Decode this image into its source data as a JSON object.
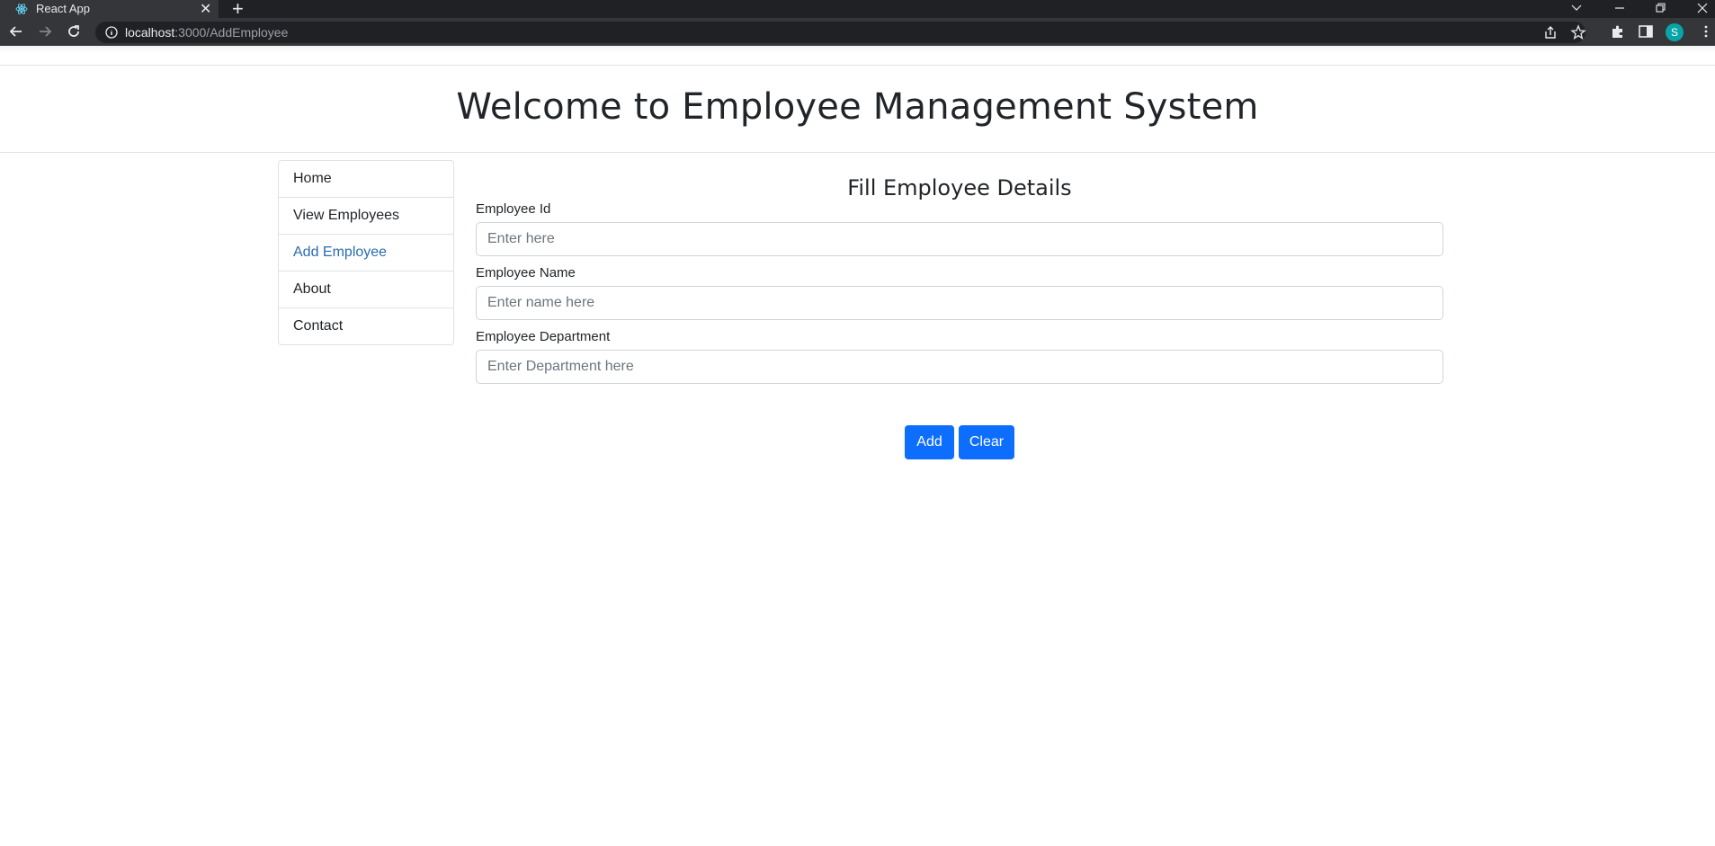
{
  "browser": {
    "tab_title": "React App",
    "url_host": "localhost",
    "url_path": ":3000/AddEmployee",
    "profile_initial": "S"
  },
  "page": {
    "heading": "Welcome to Employee Management System"
  },
  "sidebar": {
    "items": [
      {
        "label": "Home"
      },
      {
        "label": "View Employees"
      },
      {
        "label": "Add Employee"
      },
      {
        "label": "About"
      },
      {
        "label": "Contact"
      }
    ]
  },
  "form": {
    "title": "Fill Employee Details",
    "fields": [
      {
        "label": "Employee Id",
        "placeholder": "Enter here",
        "value": ""
      },
      {
        "label": "Employee Name",
        "placeholder": "Enter name here",
        "value": ""
      },
      {
        "label": "Employee Department",
        "placeholder": "Enter Department here",
        "value": ""
      }
    ],
    "add_label": "Add",
    "clear_label": "Clear"
  },
  "colors": {
    "primary": "#0d6efd",
    "active_link": "#2b6cb0",
    "chrome_dark": "#202124"
  }
}
